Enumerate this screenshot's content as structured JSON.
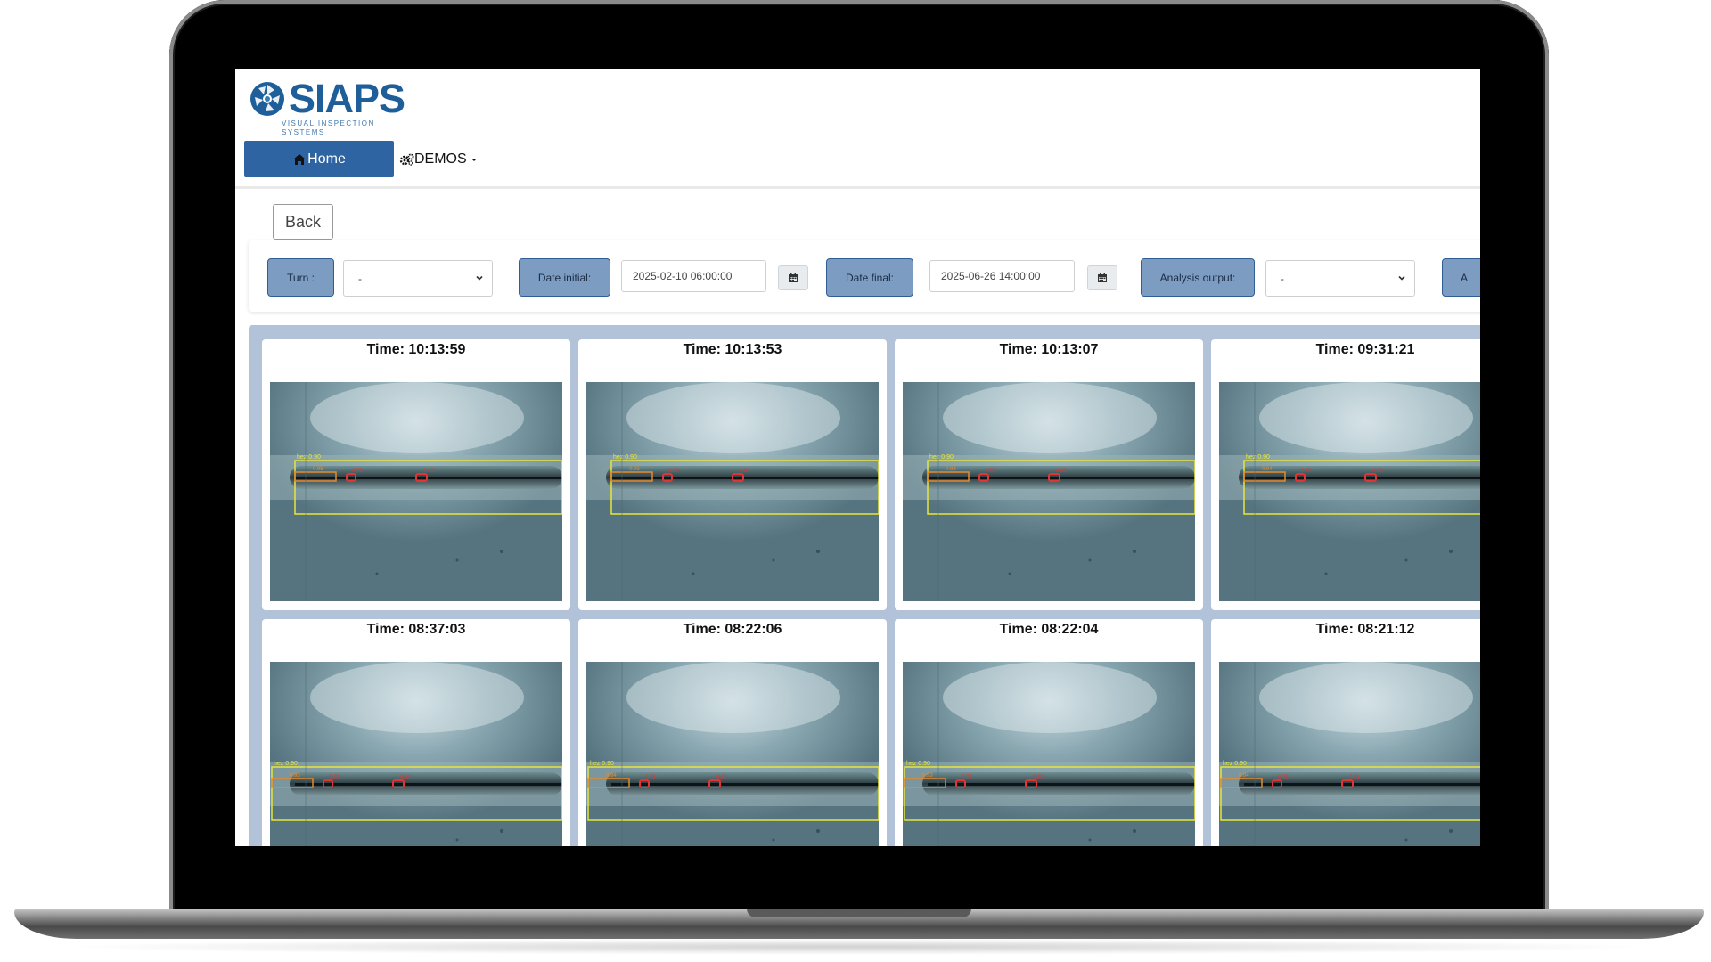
{
  "brand": {
    "name": "SIAPS",
    "tagline": "VISUAL INSPECTION SYSTEMS",
    "color": "#1f5f99"
  },
  "nav": {
    "home": {
      "label": "Home",
      "icon": "home-icon"
    },
    "demos": {
      "label": "DEMOS",
      "icon": "gears-icon"
    }
  },
  "back_button": "Back",
  "filters": {
    "turn": {
      "label": "Turn :",
      "value": "-"
    },
    "date_initial": {
      "label": "Date initial:",
      "value": "2025-02-10 06:00:00"
    },
    "date_final": {
      "label": "Date final:",
      "value": "2025-06-26 14:00:00"
    },
    "analysis_output": {
      "label": "Analysis output:",
      "value": "-"
    },
    "more": {
      "label": "A"
    }
  },
  "cards": [
    {
      "title": "Time: 10:13:59",
      "top_label": "hez 0.90",
      "labels": [
        "0.95",
        "0.79",
        "0.82"
      ]
    },
    {
      "title": "Time: 10:13:53",
      "top_label": "hez 0.90",
      "labels": [
        "0.93",
        "0.80",
        "0.81"
      ]
    },
    {
      "title": "Time: 10:13:07",
      "top_label": "hez 0.90",
      "labels": [
        "0.93",
        "0.78",
        "0.83"
      ]
    },
    {
      "title": "Time: 09:31:21",
      "top_label": "hez 0.90",
      "labels": [
        "0.94",
        "0.78",
        "0.80"
      ]
    },
    {
      "title": "Time: 08:37:03",
      "top_label": "hez 0.90",
      "labels": [
        "0.93",
        "0.79",
        "0.84"
      ]
    },
    {
      "title": "Time: 08:22:06",
      "top_label": "hez 0.90",
      "labels": [
        "0.94",
        "0.78",
        "0.81"
      ]
    },
    {
      "title": "Time: 08:22:04",
      "top_label": "hez 0.90",
      "labels": [
        "0.93",
        "0.79",
        "0.80"
      ]
    },
    {
      "title": "Time: 08:21:12",
      "top_label": "hez 0.90",
      "labels": [
        "0.94",
        "0.78",
        "0.81"
      ]
    }
  ],
  "colors": {
    "primary": "#2f64a3",
    "filter_label_bg": "#7d9cc2",
    "panel_bg": "#b2c3d9",
    "detection_box": "#e6e63a",
    "defect_box": "#e23434",
    "start_box": "#e88a2a"
  }
}
